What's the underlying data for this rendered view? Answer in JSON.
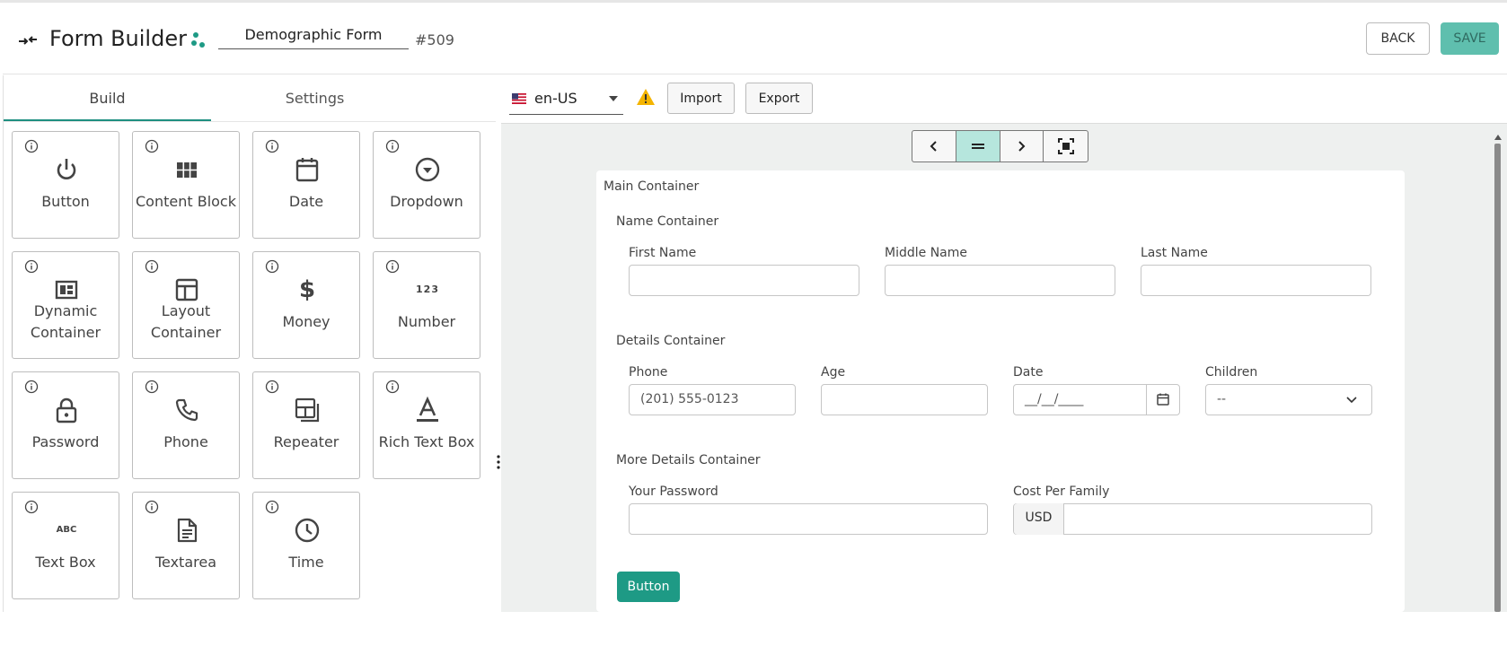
{
  "header": {
    "title": "Form Builder",
    "form_name": "Demographic Form",
    "form_id": "#509",
    "back_label": "BACK",
    "save_label": "SAVE"
  },
  "left_panel": {
    "tabs": [
      {
        "label": "Build",
        "active": true
      },
      {
        "label": "Settings",
        "active": false
      }
    ],
    "components": [
      {
        "label": "Button",
        "icon": "power-icon"
      },
      {
        "label": "Content Block",
        "icon": "grid-icon"
      },
      {
        "label": "Date",
        "icon": "calendar-icon"
      },
      {
        "label": "Dropdown",
        "icon": "dropdown-circle-icon"
      },
      {
        "label_lines": [
          "Dynamic",
          "Container"
        ],
        "icon": "dynamic-container-icon"
      },
      {
        "label_lines": [
          "Layout",
          "Container"
        ],
        "icon": "layout-icon"
      },
      {
        "label": "Money",
        "icon": "dollar-icon"
      },
      {
        "label": "Number",
        "icon": "numbers-icon"
      },
      {
        "label": "Password",
        "icon": "lock-icon"
      },
      {
        "label": "Phone",
        "icon": "phone-icon"
      },
      {
        "label": "Repeater",
        "icon": "repeater-icon"
      },
      {
        "label": "Rich Text Box",
        "icon": "text-format-icon"
      },
      {
        "label": "Text Box",
        "icon": "abc-icon"
      },
      {
        "label": "Textarea",
        "icon": "document-icon"
      },
      {
        "label": "Time",
        "icon": "clock-icon"
      }
    ],
    "number_glyph": "123",
    "abc_glyph": "ABC",
    "dollar_glyph": "$"
  },
  "toolbar": {
    "locale": "en-US",
    "import_label": "Import",
    "export_label": "Export"
  },
  "canvas": {
    "main_container": "Main Container",
    "name_container": {
      "title": "Name Container",
      "fields": [
        "First Name",
        "Middle Name",
        "Last Name"
      ]
    },
    "details_container": {
      "title": "Details Container",
      "phone_label": "Phone",
      "phone_placeholder": "(201) 555-0123",
      "age_label": "Age",
      "date_label": "Date",
      "date_placeholder": "__/__/____",
      "children_label": "Children",
      "children_value": "--"
    },
    "more_details_container": {
      "title": "More Details Container",
      "password_label": "Your Password",
      "cost_label": "Cost Per Family",
      "currency": "USD"
    },
    "button_label": "Button"
  },
  "colors": {
    "accent": "#1e9a85",
    "save_bg": "#5fbfae",
    "active_nav": "#b6e6dd",
    "warning": "#f4b400"
  }
}
